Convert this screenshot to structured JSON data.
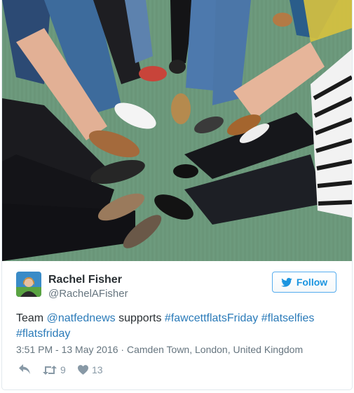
{
  "tweet": {
    "author_name": "Rachel Fisher",
    "author_handle": "@RachelAFisher",
    "follow_label": "Follow",
    "text": {
      "prefix": "Team ",
      "mention": "@natfednews",
      "middle": " supports ",
      "hashtag1": "#fawcettflatsFriday",
      "space": " ",
      "hashtag2": "#flatselfies",
      "hashtag3": "#flatsfriday"
    },
    "timestamp": "3:51 PM - 13 May 2016",
    "separator": " · ",
    "location": "Camden Town, London, United Kingdom",
    "retweets": "9",
    "likes": "13"
  },
  "icons": {
    "follow": "twitter-bird-icon",
    "reply": "reply-icon",
    "retweet": "retweet-icon",
    "like": "heart-icon"
  },
  "colors": {
    "link": "#2b7bb9",
    "follow": "#1b95e0",
    "follow_border": "#55acee",
    "meta": "#66757f"
  }
}
